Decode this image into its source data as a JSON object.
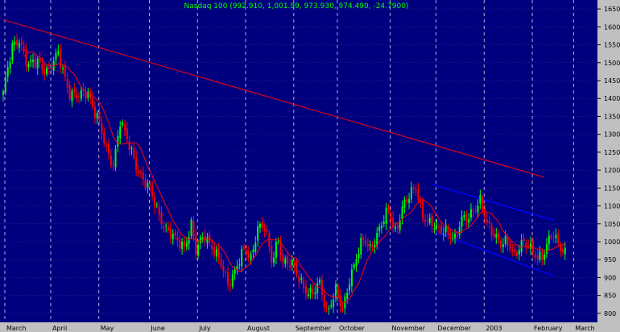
{
  "chart_data": {
    "type": "candlestick",
    "title": "Nasdaq 100 (992.910, 1,001.99, 973.930, 974.490, -24.7900)",
    "ylim": [
      775,
      1675
    ],
    "yticks": [
      800,
      850,
      900,
      950,
      1000,
      1050,
      1100,
      1150,
      1200,
      1250,
      1300,
      1350,
      1400,
      1450,
      1500,
      1550,
      1600,
      1650
    ],
    "ytick_labels": [
      "800",
      "850",
      "900",
      "950",
      "1000",
      "1050",
      "1100",
      "1150",
      "1200",
      "1250",
      "1300",
      "1350",
      "1400",
      "1450",
      "1500",
      "1550",
      "1600",
      "1650"
    ],
    "xlabels": [
      "March",
      "April",
      "May",
      "June",
      "July",
      "August",
      "September",
      "October",
      "November",
      "December",
      "2003",
      "February",
      "March"
    ],
    "xlim": [
      0,
      250
    ],
    "month_starts": [
      0,
      20,
      41,
      63,
      84,
      105,
      126,
      145,
      168,
      188,
      209,
      230,
      248
    ],
    "colors": {
      "background": "#00007f",
      "up": "#00ff00",
      "down": "#ff0000",
      "moving_average": "#ff0000",
      "trendline": "#ff0000",
      "channel": "#0000ff",
      "gridline": "#ffffff",
      "axis_background": "#c0c0c0",
      "title": "#00ff00"
    },
    "grid": true,
    "trendline": {
      "x": [
        0,
        236
      ],
      "y": [
        1620,
        1180
      ]
    },
    "channel_upper": {
      "x": [
        187,
        240
      ],
      "y": [
        1160,
        1060
      ]
    },
    "channel_lower": {
      "x": [
        187,
        240
      ],
      "y": [
        1030,
        905
      ]
    },
    "ohlc_anchors": {
      "x": [
        0,
        4,
        7,
        11,
        15,
        20,
        24,
        29,
        33,
        37,
        41,
        45,
        48,
        51,
        55,
        60,
        63,
        67,
        71,
        75,
        79,
        82,
        84,
        88,
        92,
        95,
        98,
        102,
        105,
        108,
        111,
        114,
        117,
        120,
        122,
        126,
        129,
        132,
        135,
        138,
        141,
        145,
        148,
        151,
        154,
        157,
        160,
        164,
        168,
        171,
        174,
        177,
        180,
        183,
        186,
        189,
        193,
        197,
        200,
        204,
        208,
        211,
        214,
        217,
        220,
        223,
        226,
        230,
        233,
        236,
        239,
        242,
        245
      ],
      "close": [
        1415,
        1540,
        1570,
        1490,
        1500,
        1480,
        1520,
        1420,
        1400,
        1420,
        1350,
        1250,
        1220,
        1340,
        1260,
        1190,
        1150,
        1090,
        1040,
        1000,
        990,
        1050,
        970,
        1020,
        980,
        930,
        880,
        940,
        970,
        950,
        1050,
        1040,
        940,
        1010,
        950,
        930,
        900,
        870,
        850,
        880,
        810,
        860,
        800,
        900,
        960,
        1000,
        980,
        1040,
        1080,
        1030,
        1100,
        1120,
        1150,
        1080,
        1050,
        1030,
        1040,
        1000,
        1060,
        1085,
        1105,
        1050,
        1030,
        990,
        990,
        970,
        1000,
        975,
        960,
        975,
        1015,
        995,
        975
      ]
    },
    "ma_period": 10
  }
}
